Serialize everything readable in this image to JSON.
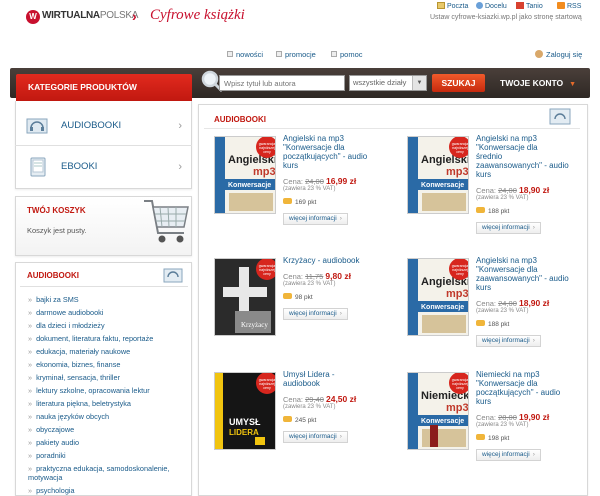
{
  "brand": {
    "logo_text_bold": "WIRTUALNA",
    "logo_text_light": "POLSKA",
    "service": "Cyfrowe książki"
  },
  "toplinks": {
    "poczta": "Poczta",
    "docelu": "Docelu",
    "tanio": "Tanio",
    "rss": "RSS"
  },
  "set_home": "Ustaw cyfrowe-ksiazki.wp.pl jako stronę startową",
  "nav": {
    "nowosci": "nowości",
    "promocje": "promocje",
    "pomoc": "pomoc",
    "login": "Zaloguj się"
  },
  "searchbar": {
    "categories_header": "KATEGORIE PRODUKTÓW",
    "placeholder": "Wpisz tytuł lub autora",
    "select_value": "wszystkie działy",
    "button": "SZUKAJ",
    "account": "TWOJE KONTO"
  },
  "categories": [
    {
      "label": "AUDIOBOOKI"
    },
    {
      "label": "EBOOKI"
    }
  ],
  "cart": {
    "title": "TWÓJ KOSZYK",
    "empty": "Koszyk jest pusty."
  },
  "audiobooks_menu": {
    "title": "AUDIOBOOKI",
    "items": [
      "bajki za SMS",
      "darmowe audiobooki",
      "dla dzieci i młodzieży",
      "dokument, literatura faktu, reportaże",
      "edukacja, materiały naukowe",
      "ekonomia, biznes, finanse",
      "kryminał, sensacja, thriller",
      "lektury szkolne, opracowania lektur",
      "literatura piękna, beletrystyka",
      "nauka języków obcych",
      "obyczajowe",
      "pakiety audio",
      "poradniki",
      "praktyczna edukacja, samodoskonalenie, motywacja",
      "psychologia"
    ]
  },
  "main": {
    "title": "AUDIOBOOKI",
    "price_label": "Cena:",
    "vat": "(zawiera 23 % VAT)",
    "more": "więcej informacji",
    "products": [
      {
        "title_lines": [
          "Angielski na mp3",
          "\"Konwersacje dla",
          "początkujących\" - audio",
          "kurs"
        ],
        "old": "24,00",
        "new": "16,99 zł",
        "points": "169 pkt",
        "cover": "konw"
      },
      {
        "title_lines": [
          "Angielski na mp3",
          "\"Konwersacje dla",
          "średnio",
          "zaawansowanych\" - audio",
          "kurs"
        ],
        "old": "24,00",
        "new": "18,90 zł",
        "points": "188 pkt",
        "cover": "konw"
      },
      {
        "title_lines": [
          "Krzyżacy - audiobook"
        ],
        "old": "11,75",
        "new": "9,80 zł",
        "points": "98 pkt",
        "cover": "krzy"
      },
      {
        "title_lines": [
          "Angielski na mp3",
          "\"Konwersacje dla",
          "zaawansowanych\" - audio",
          "kurs"
        ],
        "old": "24,00",
        "new": "18,90 zł",
        "points": "188 pkt",
        "cover": "konw"
      },
      {
        "title_lines": [
          "Umysł Lidera -",
          "audiobook"
        ],
        "old": "29,40",
        "new": "24,50 zł",
        "points": "245 pkt",
        "cover": "umysl"
      },
      {
        "title_lines": [
          "Niemiecki na mp3",
          "\"Konwersacje dla",
          "początkujących\" - audio",
          "kurs"
        ],
        "old": "28,00",
        "new": "19,90 zł",
        "points": "198 pkt",
        "cover": "niem"
      }
    ]
  },
  "covers": {
    "konw": {
      "stamp": "gwarancja najniższej ceny",
      "top": "Angielski",
      "mp3": "mp3",
      "band": "Konwersacje"
    },
    "niem": {
      "stamp": "gwarancja najniższej ceny",
      "top": "Niemiecki",
      "mp3": "mp3",
      "band": "Konwersacje"
    },
    "krzy": {
      "stamp": "gwarancja najniższej ceny",
      "title": "Krzyżacy"
    },
    "umysl": {
      "stamp": "gwarancja najniższej ceny",
      "title": "UMYSŁ LIDERA"
    }
  },
  "colors": {
    "brand_red": "#c11810",
    "link_blue": "#1a5b8a",
    "dark_bar": "#3a322e",
    "search_orange": "#e0451d"
  }
}
